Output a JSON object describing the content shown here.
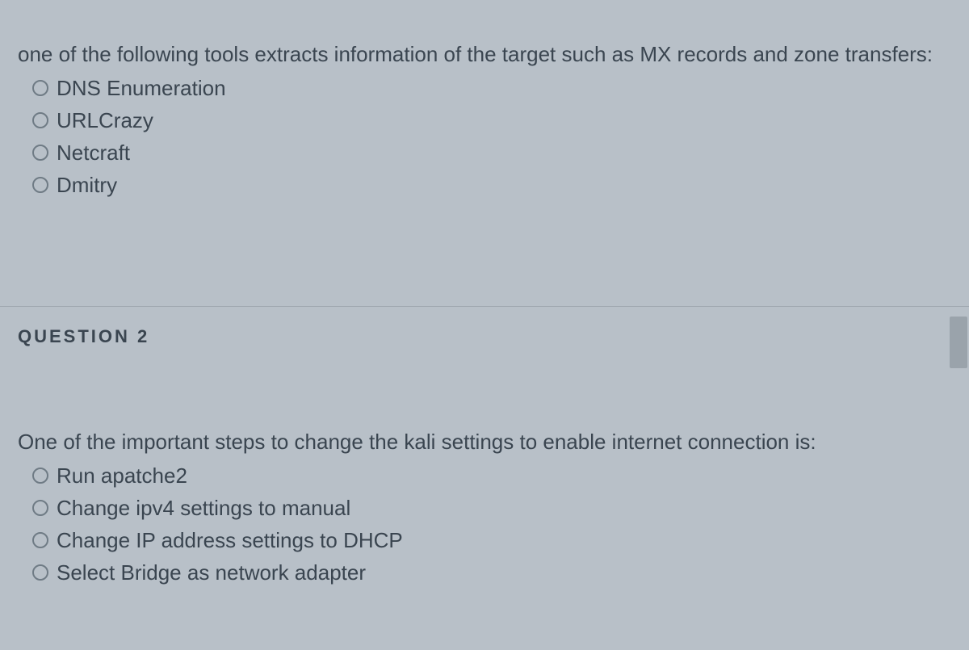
{
  "question1": {
    "prompt": "one of the following tools extracts information of the target such as MX records and zone transfers:",
    "options": [
      "DNS Enumeration",
      "URLCrazy",
      "Netcraft",
      "Dmitry"
    ]
  },
  "heading2": "QUESTION 2",
  "question2": {
    "prompt": "One of the important steps to change the kali settings to enable internet connection is:",
    "options": [
      "Run apatche2",
      "Change ipv4 settings to manual",
      "Change IP address settings to DHCP",
      "Select Bridge as network adapter"
    ]
  }
}
